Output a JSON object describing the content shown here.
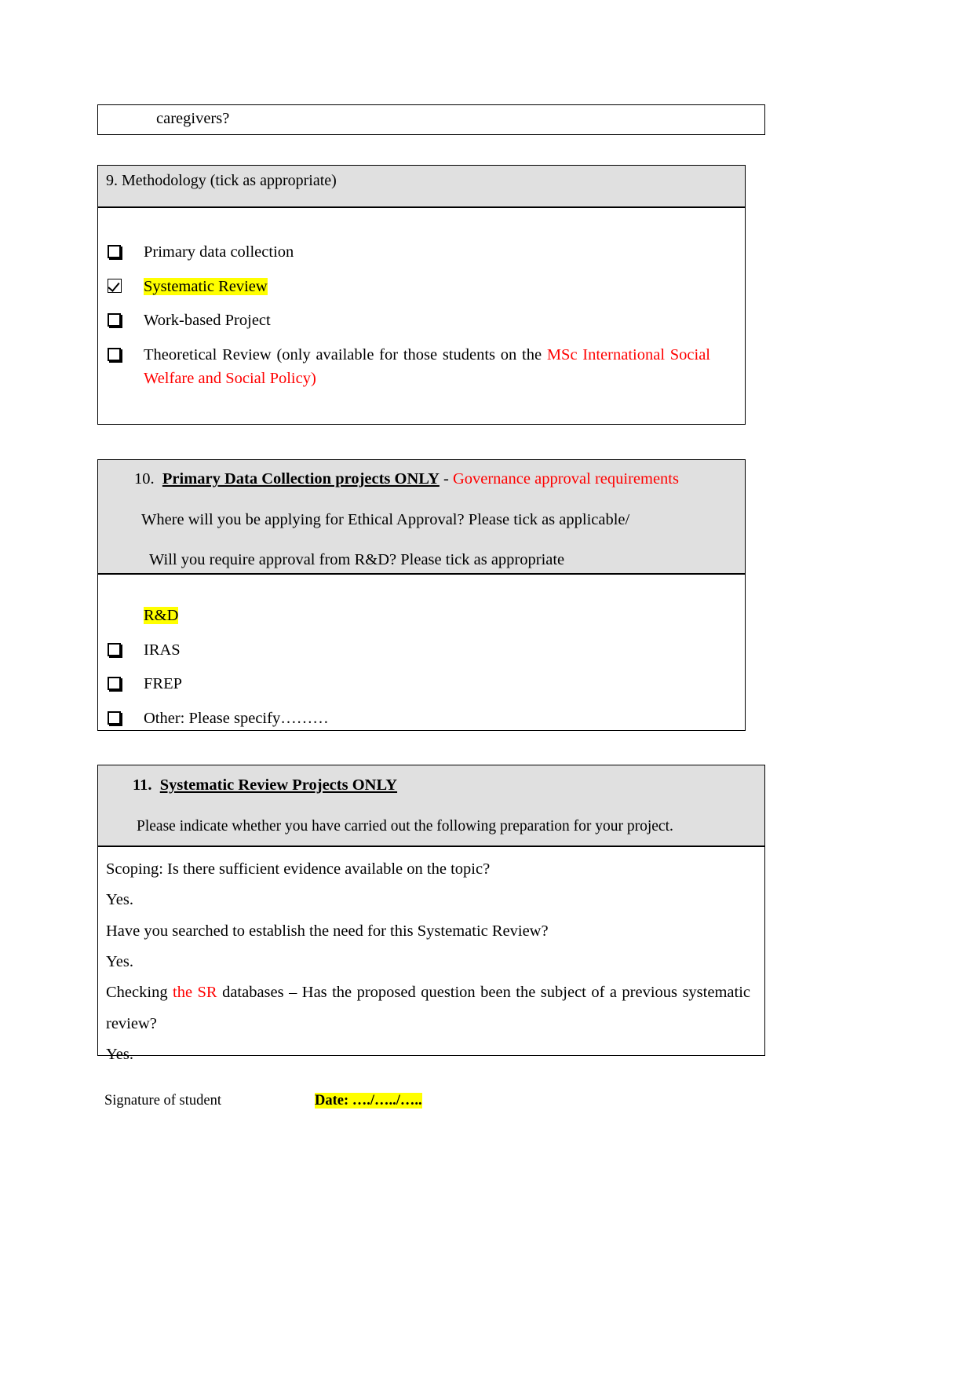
{
  "document": {
    "carryover_text": "caregivers?"
  },
  "q9": {
    "heading": "9.  Methodology (tick as appropriate)",
    "options": [
      {
        "checked": false,
        "label": "Primary data collection",
        "highlighted": false
      },
      {
        "checked": true,
        "label": "Systematic Review",
        "highlighted": true
      },
      {
        "checked": false,
        "label": "Work-based Project",
        "highlighted": false
      },
      {
        "checked": false,
        "label": "Theoretical Review (only available for those students on the ",
        "highlighted": false,
        "red_tail": "MSc International Social Welfare and Social Policy)"
      }
    ]
  },
  "q10": {
    "number": "10.",
    "title": "Primary Data Collection projects ONLY",
    "dash": " - ",
    "red_subtitle": "Governance approval requirements",
    "line_1": "Where will you be applying for Ethical Approval? Please tick  as applicable/",
    "line_2": "Will you require approval from R&D? Please tick as appropriate",
    "rd_label": "R&D",
    "options": [
      {
        "checked": false,
        "label": "IRAS"
      },
      {
        "checked": false,
        "label": "FREP"
      },
      {
        "checked": false,
        "label": "Other: Please specify………"
      }
    ]
  },
  "q11": {
    "number": "11.",
    "title": "Systematic Review Projects ONLY",
    "instruction": "Please indicate whether you have carried out the following preparation for your project.",
    "items": [
      {
        "question": "Scoping: Is there sufficient evidence available on the topic?",
        "answer": "Yes."
      },
      {
        "question": "Have you searched to establish the need for this Systematic Review?",
        "answer": "Yes."
      },
      {
        "question_pre": "Checking ",
        "question_red": "the SR",
        "question_post": " databases – Has the proposed question been the subject of a previous systematic review?",
        "answer": "Yes."
      }
    ]
  },
  "signature": {
    "label": "Signature of student",
    "date_label": "Date: …./…../….."
  },
  "colors": {
    "red": "#ff0000",
    "highlight": "#ffff00",
    "shading": "#e0e0e0",
    "border": "#000000"
  }
}
